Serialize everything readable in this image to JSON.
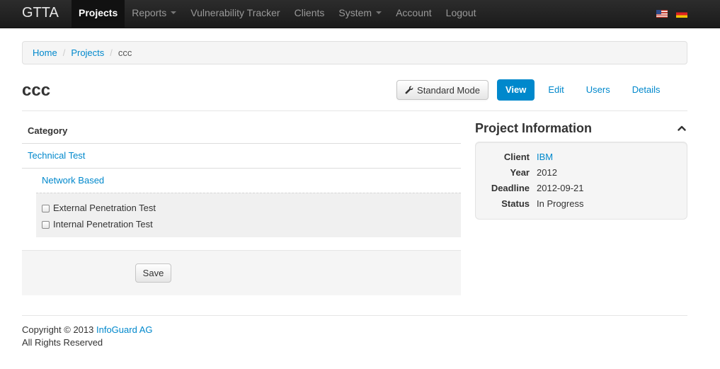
{
  "navbar": {
    "brand": "GTTA",
    "items": [
      {
        "label": "Projects",
        "active": true,
        "dropdown": false
      },
      {
        "label": "Reports",
        "active": false,
        "dropdown": true
      },
      {
        "label": "Vulnerability Tracker",
        "active": false,
        "dropdown": false
      },
      {
        "label": "Clients",
        "active": false,
        "dropdown": false
      },
      {
        "label": "System",
        "active": false,
        "dropdown": true
      },
      {
        "label": "Account",
        "active": false,
        "dropdown": false
      },
      {
        "label": "Logout",
        "active": false,
        "dropdown": false
      }
    ],
    "flags": [
      "us-flag-icon",
      "de-flag-icon"
    ]
  },
  "breadcrumb": {
    "items": [
      "Home",
      "Projects"
    ],
    "current": "ccc",
    "separator": "/"
  },
  "page": {
    "title": "ccc",
    "standard_mode_label": "Standard Mode",
    "tabs": [
      {
        "label": "View",
        "active": true
      },
      {
        "label": "Edit",
        "active": false
      },
      {
        "label": "Users",
        "active": false
      },
      {
        "label": "Details",
        "active": false
      }
    ]
  },
  "category_table": {
    "header": "Category",
    "category": "Technical Test",
    "subcategory": "Network Based",
    "checks": [
      {
        "label": "External Penetration Test",
        "checked": false
      },
      {
        "label": "Internal Penetration Test",
        "checked": false
      }
    ],
    "save_label": "Save"
  },
  "project_info": {
    "title": "Project Information",
    "fields": [
      {
        "label": "Client",
        "value": "IBM",
        "link": true
      },
      {
        "label": "Year",
        "value": "2012",
        "link": false
      },
      {
        "label": "Deadline",
        "value": "2012-09-21",
        "link": false
      },
      {
        "label": "Status",
        "value": "In Progress",
        "link": false
      }
    ]
  },
  "footer": {
    "copyright_prefix": "Copyright © 2013 ",
    "company": "InfoGuard AG",
    "rights": "All Rights Reserved"
  },
  "colors": {
    "accent": "#0088cc",
    "navbar_bg": "#1b1b1b",
    "well_bg": "#f5f5f5"
  }
}
